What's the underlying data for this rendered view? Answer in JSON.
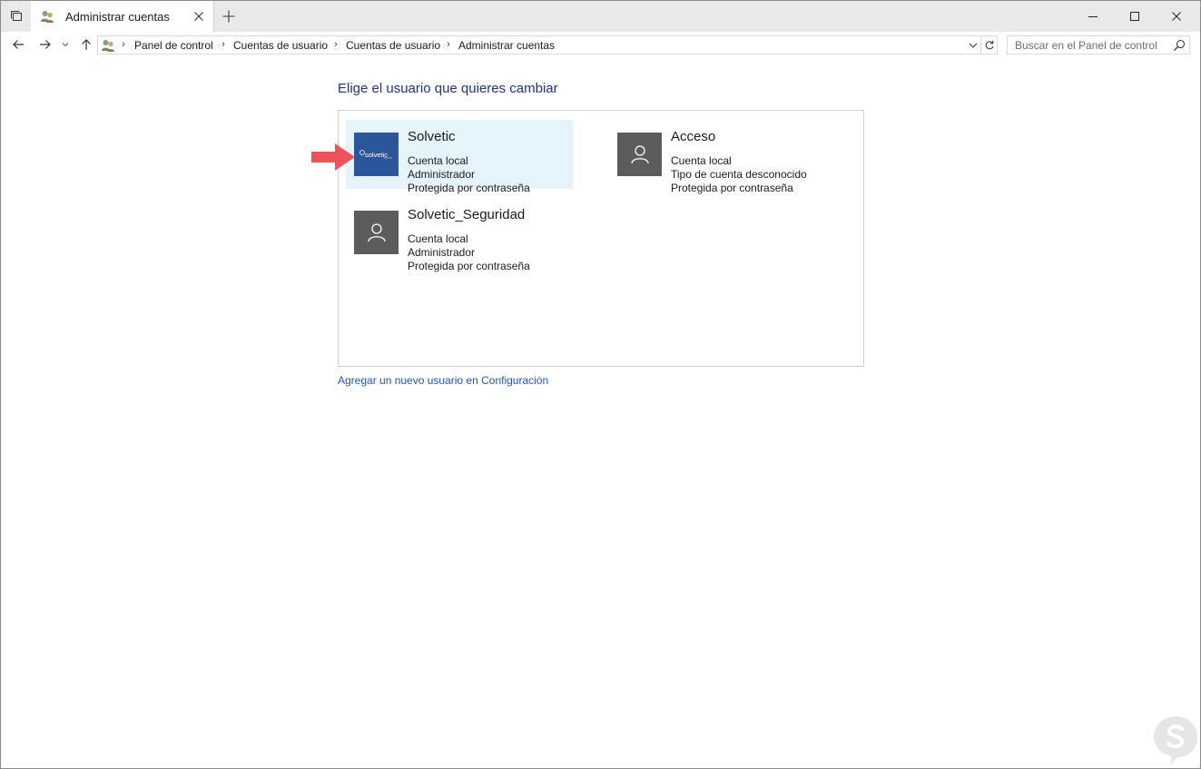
{
  "window": {
    "tab_title": "Administrar cuentas",
    "controls": {
      "minimize": "minimize-icon",
      "maximize": "maximize-icon",
      "close": "close-icon"
    }
  },
  "navigation": {
    "breadcrumbs": [
      "Panel de control",
      "Cuentas de usuario",
      "Cuentas de usuario",
      "Administrar cuentas"
    ],
    "search_placeholder": "Buscar en el Panel de control"
  },
  "main": {
    "heading": "Elige el usuario que quieres cambiar",
    "accounts": [
      {
        "name": "Solvetic",
        "lines": [
          "Cuenta local",
          "Administrador",
          "Protegida por contraseña"
        ],
        "avatar": "solvetic",
        "selected": true
      },
      {
        "name": "Acceso",
        "lines": [
          "Cuenta local",
          "Tipo de cuenta desconocido",
          "Protegida por contraseña"
        ],
        "avatar": "user-icon",
        "selected": false
      },
      {
        "name": "Solvetic_Seguridad",
        "lines": [
          "Cuenta local",
          "Administrador",
          "Protegida por contraseña"
        ],
        "avatar": "user-icon",
        "selected": false
      }
    ],
    "add_user_link": "Agregar un nuevo usuario en Configuración"
  },
  "colors": {
    "heading": "#1e3287",
    "link": "#2256b4",
    "selected_bg": "#e5f3fb",
    "avatar_default": "#5c5c5c",
    "avatar_brand": "#2b569a",
    "arrow": "#f0525a"
  }
}
